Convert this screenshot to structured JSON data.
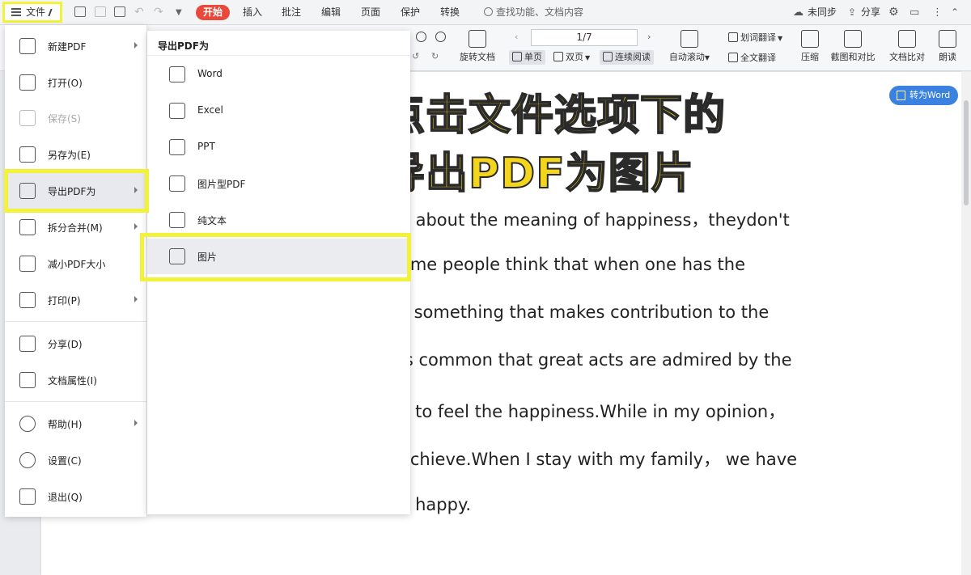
{
  "menubar": {
    "file_label": "文件",
    "tabs": [
      "开始",
      "插入",
      "批注",
      "编辑",
      "页面",
      "保护",
      "转换"
    ],
    "search_placeholder": "查找功能、文档内容",
    "sync": "未同步",
    "share": "分享"
  },
  "ribbon": {
    "rotate_doc": "旋转文档",
    "page_indicator": "1/7",
    "single_page": "单页",
    "double_page": "双页",
    "continuous": "连续阅读",
    "auto_scroll": "自动滚动",
    "word_translate": "划词翻译",
    "full_translate": "全文翻译",
    "compress": "压缩",
    "screenshot_compare": "截图和对比",
    "doc_compare": "文档比对",
    "read_aloud": "朗读"
  },
  "file_menu": {
    "items": [
      {
        "label": "新建PDF",
        "icon": "new-pdf-icon",
        "has_arrow": true
      },
      {
        "label": "打开(O)",
        "icon": "folder-open-icon",
        "has_arrow": false
      },
      {
        "label": "保存(S)",
        "icon": "save-icon",
        "has_arrow": false,
        "disabled": true
      },
      {
        "label": "另存为(E)",
        "icon": "save-as-icon",
        "has_arrow": false
      },
      {
        "label": "导出PDF为",
        "icon": "export-pdf-icon",
        "has_arrow": true,
        "active": true
      },
      {
        "label": "拆分合并(M)",
        "icon": "split-merge-icon",
        "has_arrow": true
      },
      {
        "label": "减小PDF大小",
        "icon": "compress-icon",
        "has_arrow": false
      },
      {
        "label": "打印(P)",
        "icon": "printer-icon",
        "has_arrow": true
      },
      {
        "label": "分享(D)",
        "icon": "share-icon",
        "has_arrow": false
      },
      {
        "label": "文档属性(I)",
        "icon": "doc-properties-icon",
        "has_arrow": false
      },
      {
        "label": "帮助(H)",
        "icon": "help-icon",
        "has_arrow": true
      },
      {
        "label": "设置(C)",
        "icon": "gear-icon",
        "has_arrow": false
      },
      {
        "label": "退出(Q)",
        "icon": "exit-icon",
        "has_arrow": false
      }
    ]
  },
  "export_submenu": {
    "title": "导出PDF为",
    "items": [
      {
        "label": "Word",
        "icon": "word-icon"
      },
      {
        "label": "Excel",
        "icon": "excel-icon"
      },
      {
        "label": "PPT",
        "icon": "ppt-icon"
      },
      {
        "label": "图片型PDF",
        "icon": "image-pdf-icon"
      },
      {
        "label": "纯文本",
        "icon": "plain-text-icon"
      },
      {
        "label": "图片",
        "icon": "image-icon",
        "highlighted": true
      }
    ]
  },
  "annotation": {
    "line1": "点击文件选项下的",
    "line2": "导出PDF为图片"
  },
  "to_word_button": "转为Word",
  "document": {
    "lines": [
      "e about the meaning of happiness，theydon't",
      "ome   people   think   that   when   one   has   the",
      "s  something  that  makes  contribution  to  the",
      "is common that great acts are admired by the",
      "y to feel the happiness.While in my opinion，",
      "achieve.When I stay with my family， we have",
      "y happy."
    ]
  },
  "colors": {
    "highlight": "#f2f23a",
    "annotation_text": "#f4d51d",
    "start_tab": "#e9493b",
    "to_word": "#3b82e0"
  }
}
